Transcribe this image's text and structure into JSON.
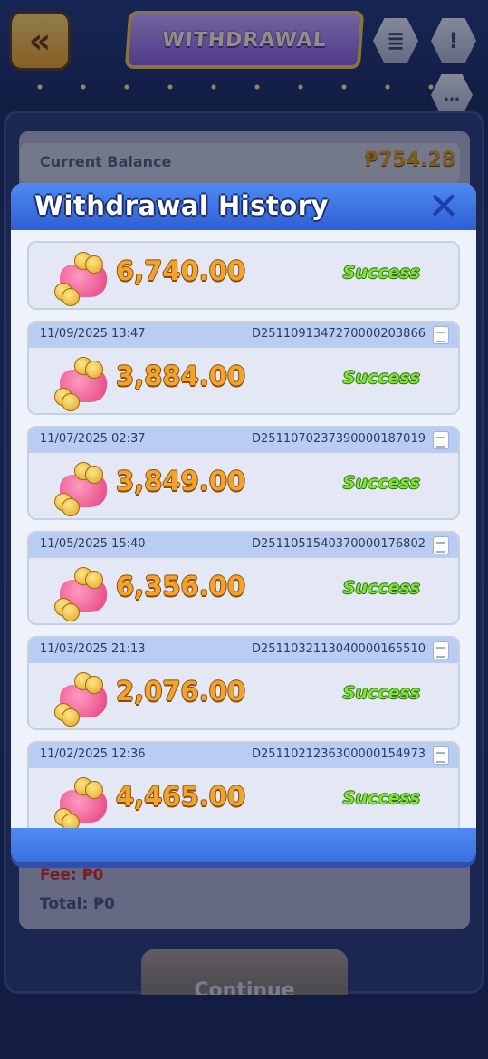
{
  "header": {
    "back_icon": "double-chevron-left-icon",
    "title": "WITHDRAWAL",
    "icons": [
      "receipt-icon",
      "exclamation-icon",
      "chat-icon"
    ]
  },
  "balance": {
    "label": "Current Balance",
    "value": "₱754.28"
  },
  "summary": {
    "fee": "Fee: ₱0",
    "total": "Total: ₱0",
    "continue_label": "Continue"
  },
  "history": {
    "title": "Withdrawal History",
    "close_symbol": "✕",
    "records": [
      {
        "date": "",
        "order_id": "",
        "amount": "6,740.00",
        "status": "Success"
      },
      {
        "date": "11/09/2025 13:47",
        "order_id": "D2511091347270000203866",
        "amount": "3,884.00",
        "status": "Success"
      },
      {
        "date": "11/07/2025 02:37",
        "order_id": "D2511070237390000187019",
        "amount": "3,849.00",
        "status": "Success"
      },
      {
        "date": "11/05/2025 15:40",
        "order_id": "D2511051540370000176802",
        "amount": "6,356.00",
        "status": "Success"
      },
      {
        "date": "11/03/2025 21:13",
        "order_id": "D2511032113040000165510",
        "amount": "2,076.00",
        "status": "Success"
      },
      {
        "date": "11/02/2025 12:36",
        "order_id": "D2511021236300000154973",
        "amount": "4,465.00",
        "status": "Success"
      }
    ]
  },
  "colors": {
    "accent_blue": "#2d5fd6",
    "amount_orange": "#f2a32b",
    "success_green": "#7fe33a",
    "fee_red": "#d22a2a"
  }
}
